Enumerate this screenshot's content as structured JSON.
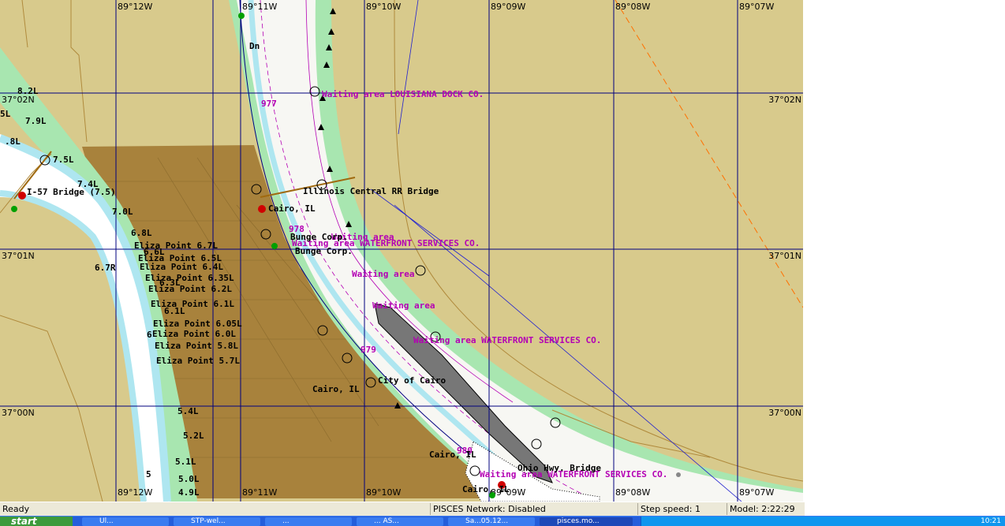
{
  "longitude_labels": [
    "89°12W",
    "89°11W",
    "89°10W",
    "89°09W",
    "89°08W",
    "89°07W"
  ],
  "latitude_labels": [
    "37°02N",
    "37°01N",
    "37°00N"
  ],
  "river_mile_labels": [
    "977",
    "978",
    "979",
    "980"
  ],
  "waiting_areas": [
    "Waiting area LOUISIANA DOCK CO.",
    "Waiting area",
    "Waiting area WATERFRONT SERVICES CO.",
    "Waiting area",
    "Waiting area",
    "Waiting area WATERFRONT SERVICES CO.",
    "Waiting area WATERFRONT SERVICES CO."
  ],
  "features": {
    "dn": "Dn",
    "i57_bridge": "I-57 Bridge (7.5)",
    "ic_bridge": "Illinois Central RR Bridge",
    "cairo_il": "Cairo, IL",
    "bunge_corp_1": "Bunge Corp.",
    "bunge_corp_2": "Bunge Corp.",
    "city_of_cairo": "City of Cairo",
    "cairo_il_2": "Cairo, IL",
    "cairo_il_3": "Cairo, IL",
    "cairo_il_4": "Cairo, IL",
    "ohio_hwy_bridge": "Ohio Hwy. Bridge"
  },
  "mile_labels": [
    "8.2L",
    "7.9L",
    "5L",
    ".8L",
    "7.5L",
    "7.4L",
    "7.0L",
    "6.8L",
    "6.7R",
    "6.6L",
    "6.3L",
    "6.1L",
    "5.4L",
    "5.2L",
    "5.1L",
    "5.0L",
    "4.9L",
    "5",
    "6"
  ],
  "eliza_points": [
    "Eliza Point 6.7L",
    "Eliza Point 6.5L",
    "Eliza Point 6.4L",
    "Eliza Point 6.35L",
    "Eliza Point 6.2L",
    "Eliza Point 6.1L",
    "Eliza Point 6.05L",
    "Eliza Point 6.0L",
    "Eliza Point 5.8L",
    "Eliza Point 5.7L"
  ],
  "status_bar": {
    "ready": "Ready",
    "network": "PISCES Network: Disabled",
    "step_speed": "Step speed: 1",
    "model": "Model: 2:22:29"
  },
  "taskbar": {
    "start": "start",
    "items": [
      "Ul...",
      "STP-wel...",
      "...",
      "... AS...",
      "Sa...05.12...",
      "pisces.mo..."
    ],
    "clock": "10:21"
  },
  "colors": {
    "land": "#d8ca8c",
    "city": "#a8823c",
    "water": "#ffffff",
    "shallow": "#aee6f0",
    "bank": "#a8e6b0",
    "grid": "#00007f",
    "magenta": "#b400b4"
  }
}
